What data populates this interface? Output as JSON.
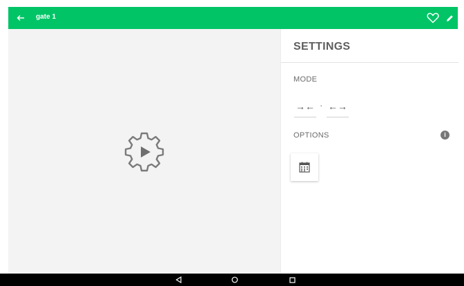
{
  "appbar": {
    "title": "gate 1",
    "back_icon": "arrow-left-icon",
    "favorite_icon": "heart-outline-icon",
    "edit_icon": "pencil-icon",
    "color": "#00c466"
  },
  "preview": {
    "icon": "gear-play-icon",
    "background": "#f3f3f3"
  },
  "settings": {
    "title": "SETTINGS",
    "mode_label": "MODE",
    "mode_options": [
      {
        "symbol": "→←",
        "icon": "arrows-inward-icon"
      },
      {
        "symbol": "←→",
        "icon": "arrows-outward-icon"
      }
    ],
    "mode_separator": "·",
    "options_label": "OPTIONS",
    "info_icon": "info-icon",
    "calendar_icon": "calendar-icon"
  },
  "navbar": {
    "back_icon": "nav-back-icon",
    "home_icon": "nav-home-icon",
    "recents_icon": "nav-recents-icon"
  }
}
